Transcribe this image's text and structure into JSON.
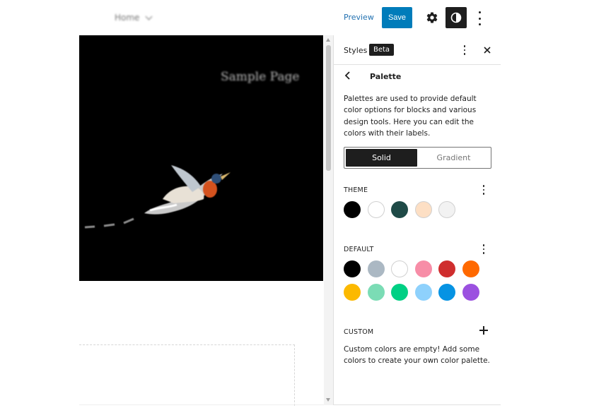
{
  "topbar": {
    "breadcrumb": "Home",
    "preview_label": "Preview",
    "save_label": "Save"
  },
  "canvas": {
    "page_title": "Sample Page"
  },
  "panel": {
    "title": "Styles",
    "badge": "Beta",
    "palette_title": "Palette",
    "description": "Palettes are used to provide default color options for blocks and various design tools. Here you can edit the colors with their labels.",
    "tabs": {
      "solid": "Solid",
      "gradient": "Gradient"
    },
    "theme_label": "THEME",
    "default_label": "DEFAULT",
    "custom_label": "CUSTOM",
    "custom_empty": "Custom colors are empty! Add some colors to create your own color palette.",
    "theme_colors": [
      "#000000",
      "#ffffff",
      "#1f4a47",
      "#fddfc4",
      "#f2f2f2"
    ],
    "default_colors": [
      "#000000",
      "#abb8c3",
      "#ffffff",
      "#f78da7",
      "#cf2e2e",
      "#ff6900",
      "#fcb900",
      "#7bdcb5",
      "#00d084",
      "#8ed1fc",
      "#0693e3",
      "#9b51e0"
    ]
  },
  "colors": {
    "accent": "#007cba",
    "link": "#2271b1",
    "dark": "#1e1e1e"
  }
}
